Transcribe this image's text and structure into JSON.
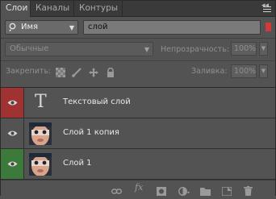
{
  "tabs": [
    {
      "label": "Слои",
      "active": true
    },
    {
      "label": "Каналы",
      "active": false
    },
    {
      "label": "Контуры",
      "active": false
    }
  ],
  "panel": {
    "collapse_glyph": "◂◂",
    "menu_icon": "panel-menu-icon"
  },
  "filter": {
    "kind_label": "Имя",
    "kind_icon": "search-icon",
    "value": "слой",
    "toggle_color": "#d23a3a"
  },
  "blend": {
    "mode": "Обычные",
    "opacity_label": "Непрозрачность:",
    "opacity_value": "100%",
    "fill_label": "Заливка:",
    "fill_value": "100%"
  },
  "lock": {
    "label": "Закрепить:",
    "icons": [
      "lock-transparent-pixels-icon",
      "lock-image-pixels-icon",
      "lock-position-icon",
      "lock-all-icon"
    ]
  },
  "layers": [
    {
      "name": "Текстовый слой",
      "type": "text",
      "visible": true,
      "label_color": "#a03232",
      "thumb_glyph": "T"
    },
    {
      "name": "Слой 1 копия",
      "type": "pixel",
      "visible": true,
      "label_color": null
    },
    {
      "name": "Слой 1",
      "type": "pixel",
      "visible": true,
      "label_color": "#3c7a3c"
    }
  ],
  "bottom_icons": [
    "link-layers-icon",
    "fx-icon",
    "layer-mask-icon",
    "adjustment-layer-icon",
    "new-group-icon",
    "new-layer-icon",
    "delete-layer-icon"
  ],
  "bottom_fx_label": "fx"
}
